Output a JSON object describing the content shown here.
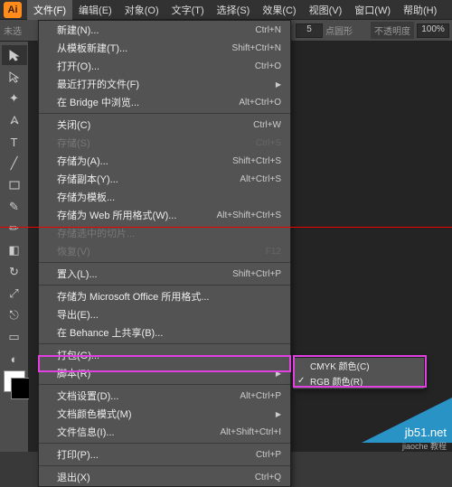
{
  "app": {
    "icon_text": "Ai",
    "untitled": "未选"
  },
  "menubar": {
    "items": [
      "文件(F)",
      "编辑(E)",
      "对象(O)",
      "文字(T)",
      "选择(S)",
      "效果(C)",
      "视图(V)",
      "窗口(W)",
      "帮助(H)"
    ]
  },
  "optionsbar": {
    "bullet": "●",
    "value": "5",
    "label": "点圆形",
    "opacity_label": "不透明度",
    "opacity_value": "100%"
  },
  "file_menu": {
    "items": [
      {
        "label": "新建(N)...",
        "shortcut": "Ctrl+N"
      },
      {
        "label": "从模板新建(T)...",
        "shortcut": "Shift+Ctrl+N"
      },
      {
        "label": "打开(O)...",
        "shortcut": "Ctrl+O"
      },
      {
        "label": "最近打开的文件(F)",
        "shortcut": "",
        "submenu": true
      },
      {
        "label": "在 Bridge 中浏览...",
        "shortcut": "Alt+Ctrl+O"
      },
      {
        "sep": true
      },
      {
        "label": "关闭(C)",
        "shortcut": "Ctrl+W"
      },
      {
        "label": "存储(S)",
        "shortcut": "Ctrl+S",
        "disabled": true
      },
      {
        "label": "存储为(A)...",
        "shortcut": "Shift+Ctrl+S"
      },
      {
        "label": "存储副本(Y)...",
        "shortcut": "Alt+Ctrl+S"
      },
      {
        "label": "存储为模板...",
        "shortcut": ""
      },
      {
        "label": "存储为 Web 所用格式(W)...",
        "shortcut": "Alt+Shift+Ctrl+S"
      },
      {
        "label": "存储选中的切片...",
        "shortcut": "",
        "disabled": true
      },
      {
        "label": "恢复(V)",
        "shortcut": "F12",
        "disabled": true
      },
      {
        "sep": true
      },
      {
        "label": "置入(L)...",
        "shortcut": "Shift+Ctrl+P"
      },
      {
        "sep": true
      },
      {
        "label": "存储为 Microsoft Office 所用格式...",
        "shortcut": ""
      },
      {
        "label": "导出(E)...",
        "shortcut": ""
      },
      {
        "label": "在 Behance 上共享(B)...",
        "shortcut": ""
      },
      {
        "sep": true
      },
      {
        "label": "打包(G)...",
        "shortcut": ""
      },
      {
        "label": "脚本(R)",
        "shortcut": "",
        "submenu": true
      },
      {
        "sep": true
      },
      {
        "label": "文档设置(D)...",
        "shortcut": "Alt+Ctrl+P"
      },
      {
        "label": "文档颜色模式(M)",
        "shortcut": "",
        "submenu": true
      },
      {
        "label": "文件信息(I)...",
        "shortcut": "Alt+Shift+Ctrl+I"
      },
      {
        "sep": true
      },
      {
        "label": "打印(P)...",
        "shortcut": "Ctrl+P"
      },
      {
        "sep": true
      },
      {
        "label": "退出(X)",
        "shortcut": "Ctrl+Q"
      }
    ]
  },
  "color_mode_submenu": {
    "items": [
      {
        "label": "CMYK 颜色(C)",
        "checked": false
      },
      {
        "label": "RGB 颜色(R)",
        "checked": true
      }
    ]
  },
  "watermark": {
    "main": "jb51.net",
    "sub": "jiaoche  教程"
  }
}
